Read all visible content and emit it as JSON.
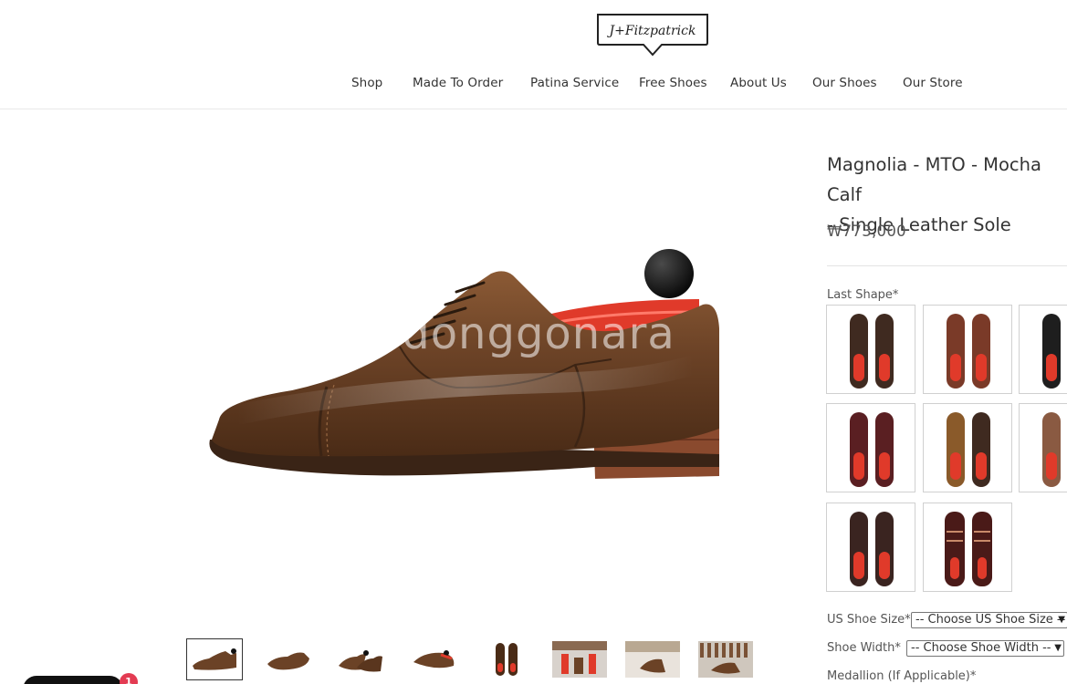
{
  "header": {
    "logo_text": "J+Fitzpatrick",
    "nav": [
      {
        "label": "Shop"
      },
      {
        "label": "Made To Order"
      },
      {
        "label": "Patina Service"
      },
      {
        "label": "Free Shoes"
      },
      {
        "label": "About Us"
      },
      {
        "label": "Our Shoes"
      },
      {
        "label": "Our Store"
      }
    ]
  },
  "gallery": {
    "watermark": "donggonara",
    "thumbnail_count": 8,
    "selected_thumbnail": 1
  },
  "product": {
    "title_line1": "Magnolia - MTO - Mocha Calf",
    "title_line2": "- Single Leather Sole",
    "price": "₩773,000"
  },
  "options": {
    "last_shape_label": "Last Shape*",
    "us_shoe_size_label": "US Shoe Size*",
    "us_shoe_size_value": "-- Choose US Shoe Size --",
    "shoe_width_label": "Shoe Width*",
    "shoe_width_value": "-- Choose Shoe Width --",
    "medallion_label": "Medallion (If Applicable)*"
  },
  "chat": {
    "badge_count": "1"
  },
  "colors": {
    "mocha": "#6b4226",
    "sole": "#8a4a2e",
    "insole_red": "#e03a2a",
    "badge": "#e33b52"
  }
}
